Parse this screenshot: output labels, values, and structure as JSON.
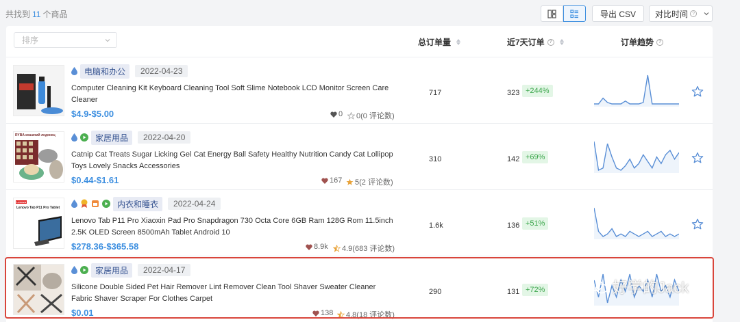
{
  "header": {
    "found_prefix": "共找到",
    "found_count": "11",
    "found_suffix": "个商品",
    "export_label": "导出 CSV",
    "compare_label": "对比时间"
  },
  "table": {
    "sort_placeholder": "排序",
    "col_total": "总订单量",
    "col_recent": "近7天订单",
    "col_trend": "订单趋势"
  },
  "rows": [
    {
      "category": "电脑和办公",
      "date": "2022-04-23",
      "title": "Computer Cleaning Kit Keyboard Cleaning Tool Soft Slime Notebook LCD Monitor Screen Care Cleaner",
      "price": "$4.9-$5.00",
      "likes": "0",
      "rating": "0(0 评论数)",
      "total_orders": "717",
      "recent_orders": "323",
      "growth": "+244%",
      "trend": [
        10,
        10,
        14,
        11,
        10,
        10,
        10,
        12,
        10,
        10,
        10,
        11,
        30,
        10,
        10,
        10,
        10,
        10,
        10,
        10
      ]
    },
    {
      "category": "家居用品",
      "date": "2022-04-20",
      "title": "Catnip Cat Treats Sugar Licking Gel Cat Energy Ball Safety Healthy Nutrition Candy Cat Lollipop Toys Lovely Snacks Accessories",
      "price": "$0.44-$1.61",
      "likes": "167",
      "rating": "5(2 评论数)",
      "total_orders": "310",
      "recent_orders": "142",
      "growth": "+69%",
      "trend": [
        36,
        10,
        12,
        34,
        22,
        12,
        10,
        14,
        20,
        12,
        16,
        24,
        18,
        12,
        22,
        16,
        24,
        28,
        20,
        26
      ]
    },
    {
      "category": "内衣和睡衣",
      "date": "2022-04-24",
      "title": "Lenovo Tab P11 Pro Xiaoxin Pad Pro Snapdragon 730 Octa Core 6GB Ram 128G Rom 11.5inch 2.5K OLED Screen 8500mAh Tablet Android 10",
      "price": "$278.36-$365.58",
      "likes": "8.9k",
      "rating": "4.9(683 评论数)",
      "total_orders": "1.6k",
      "recent_orders": "136",
      "growth": "+51%",
      "trend": [
        34,
        16,
        12,
        14,
        18,
        12,
        14,
        12,
        16,
        14,
        12,
        14,
        16,
        12,
        14,
        16,
        12,
        14,
        12,
        14
      ]
    },
    {
      "category": "家居用品",
      "date": "2022-04-17",
      "title": "Silicone Double Sided Pet Hair Remover Lint Remover Clean Tool Shaver Sweater Cleaner Fabric Shaver Scraper For Clothes Carpet",
      "price": "$0.01",
      "likes": "138",
      "rating": "4.8(18 评论数)",
      "total_orders": "290",
      "recent_orders": "131",
      "growth": "+72%",
      "trend": [
        20,
        14,
        22,
        12,
        18,
        14,
        20,
        16,
        22,
        14,
        18,
        16,
        20,
        14,
        22,
        16,
        18,
        14,
        20,
        16
      ]
    }
  ],
  "thumb_texts": {
    "cat_banner": "RYBA кошачий леденец",
    "tablet_brand": "Lenovo",
    "tablet_name": "Lenovo Tab P11 Pro Tablet"
  },
  "watermark": "好学的Jack",
  "colors": {
    "accent": "#3d8fe0",
    "growth": "#3aa54a",
    "highlight": "#d9453b"
  }
}
